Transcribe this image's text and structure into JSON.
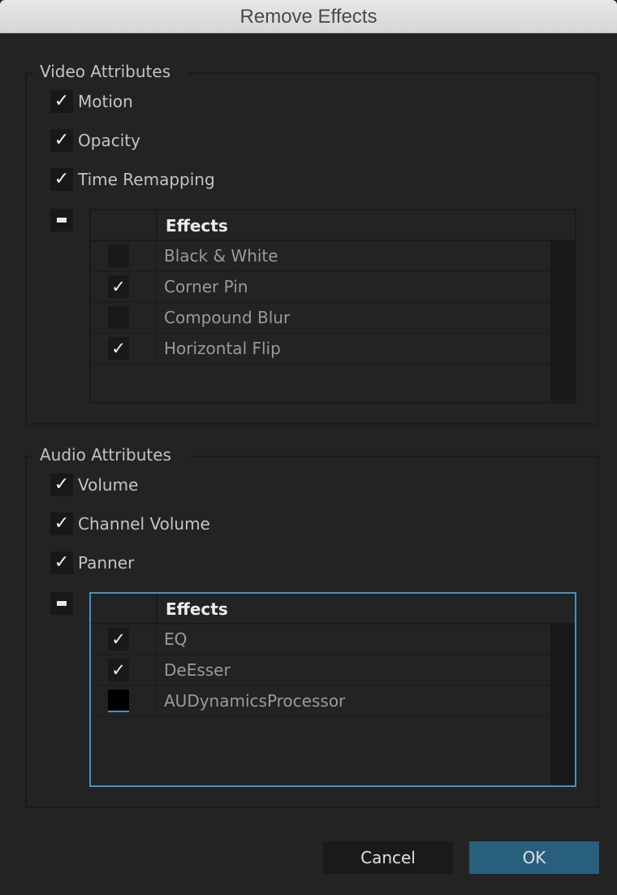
{
  "window": {
    "title": "Remove Effects"
  },
  "video": {
    "legend": "Video Attributes",
    "attributes": [
      {
        "label": "Motion",
        "checked": true
      },
      {
        "label": "Opacity",
        "checked": true
      },
      {
        "label": "Time Remapping",
        "checked": true
      }
    ],
    "effects_header": "Effects",
    "effects": [
      {
        "label": "Black & White",
        "checked": false,
        "mark": ""
      },
      {
        "label": "Corner Pin",
        "checked": true,
        "mark": "✓"
      },
      {
        "label": "Compound Blur",
        "checked": false,
        "mark": ""
      },
      {
        "label": "Horizontal Flip",
        "checked": true,
        "mark": "✓"
      }
    ]
  },
  "audio": {
    "legend": "Audio Attributes",
    "attributes": [
      {
        "label": "Volume",
        "checked": true
      },
      {
        "label": "Channel Volume",
        "checked": true
      },
      {
        "label": "Panner",
        "checked": true
      }
    ],
    "effects_header": "Effects",
    "effects": [
      {
        "label": "EQ",
        "checked": true,
        "mark": "✓"
      },
      {
        "label": "DeEsser",
        "checked": true,
        "mark": "✓"
      },
      {
        "label": "AUDynamicsProcessor",
        "checked": false,
        "mark": ""
      }
    ]
  },
  "check_mark": "✓",
  "buttons": {
    "cancel": "Cancel",
    "ok": "OK"
  },
  "colors": {
    "accent": "#3e95c2",
    "ok_button": "#275f7d",
    "background": "#232323"
  }
}
